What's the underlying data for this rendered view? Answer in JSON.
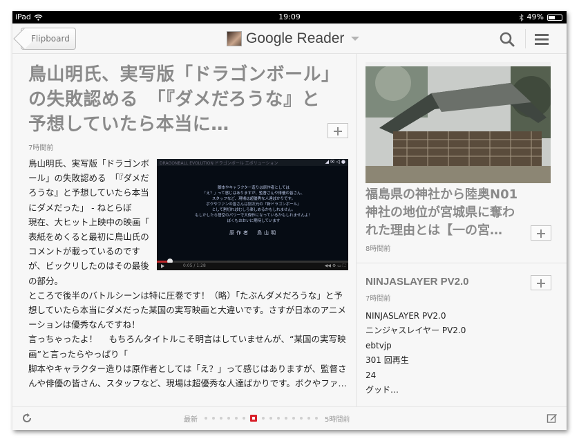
{
  "status_bar": {
    "device": "iPad",
    "time": "19:09",
    "battery": "49%",
    "battery_level": 0.49
  },
  "nav": {
    "back_label": "Flipboard",
    "title": "Google Reader"
  },
  "article_main": {
    "title": "鳥山明氏、実写版「ドラゴンボール」の失敗認める　「『ダメだろうな』と予想していたら本当に…",
    "time": "7時間前",
    "body": [
      "鳥山明氏、実写版「ドラゴンボール」の失敗認める　「『ダメだろうな』と予想していたら本当にダメだった」 - ねとらぼ",
      "現在、大ヒット上映中の映画「",
      "表紙をめくると最初に鳥山氏のコメントが載っているのですが、ビックリしたのはその最後の部分。",
      "ところで後半のバトルシーンは特に圧巻です！（略）「たぶんダメだろうな」と予想していたら本当にダメだった某国の実写映画と大違いです。さすが日本のアニメーションは優秀なんですね！",
      "言っちゃったよ！　 もちろんタイトルこそ明言はしていませんが、“某国の実写映画”と言ったらやっぱり「",
      "脚本やキャラクター造りは原作者としては「え？」って感じはありますが、監督さんや俳優の皆さん、スタッフなど、現場は超優秀な人達ばかりです。ボクやファ…"
    ],
    "video": {
      "top_label": "DRAGONBALL EVOLUTION ドラゴンボール エボリューション",
      "caption": [
        "脚本やキャラクター造りは原作者としては",
        "「え？」って感じはありますが、監督さんや俳優の皆さん、",
        "スタッフなど、現場は超優秀な人達ばかりです。",
        "ボクやファンの皆さんは別次元の『新ドラゴンボール』",
        "として割切ればむしろ楽しめるかもしれません。",
        "もしかしたら悟空のパワーで大傑作になっているかもしれませんよ！",
        "ぼくもおおいに期待しています"
      ],
      "credit": "原作者　鳥山明",
      "time": "0:05 / 1:28",
      "progress": 0.07
    }
  },
  "article_side_1": {
    "title": "福島県の神社から陸奥N01神社の地位が宮城県に奪われた理由とは【一の宮…",
    "time": "8時間前"
  },
  "article_side_2": {
    "title": "NINJASLAYER PV2.0",
    "time": "7時間前",
    "lines": [
      "NINJASLAYER PV2.0",
      "ニンジャスレイヤー PV2.0",
      "ebtvjp",
      "301 回再生",
      "24",
      "グッド…"
    ]
  },
  "footer": {
    "newest_label": "最新",
    "oldest_label": "5時間前",
    "page_count": 15,
    "active_page": 6
  },
  "colors": {
    "accent": "#d8202a",
    "title_gray": "#8a8a8a"
  },
  "icons": [
    "wifi-icon",
    "bluetooth-icon",
    "search-icon",
    "menu-icon",
    "refresh-icon",
    "compose-icon",
    "plus-icon"
  ]
}
